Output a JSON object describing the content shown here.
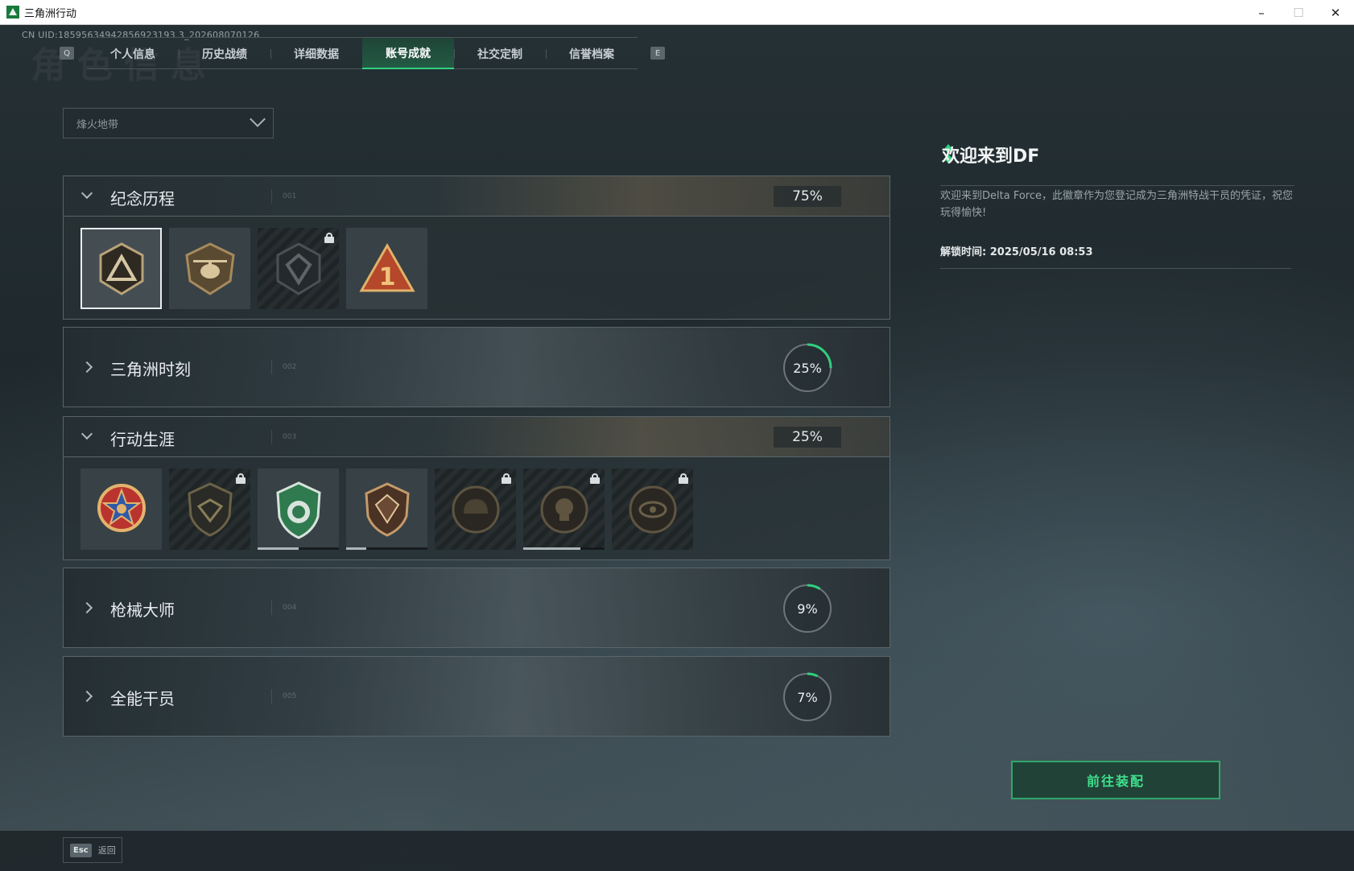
{
  "window": {
    "title": "三角洲行动",
    "controls": [
      "–",
      "☐",
      "✕"
    ]
  },
  "header": {
    "uid": "CN UID:18595634942856923193 3_202608070126",
    "watermark": "角色信息",
    "tab_prev_key": "Q",
    "tab_next_key": "E",
    "tabs": [
      {
        "label": "个人信息"
      },
      {
        "label": "历史战绩"
      },
      {
        "label": "详细数据"
      },
      {
        "label": "账号成就",
        "active": true
      },
      {
        "label": "社交定制"
      },
      {
        "label": "信誉档案"
      }
    ]
  },
  "filter": {
    "selected": "烽火地带"
  },
  "sections": [
    {
      "title": "纪念历程",
      "num": "001",
      "percent": "75%",
      "expanded": true,
      "badges": [
        {
          "name": "delta-emblem-badge",
          "locked": false,
          "selected": true
        },
        {
          "name": "helicopter-badge",
          "locked": false
        },
        {
          "name": "shield-emblem-badge",
          "locked": true
        },
        {
          "name": "rank-one-badge",
          "locked": false
        }
      ]
    },
    {
      "title": "三角洲时刻",
      "num": "002",
      "percent": "25%",
      "expanded": false,
      "progress": 0.25
    },
    {
      "title": "行动生涯",
      "num": "003",
      "percent": "25%",
      "expanded": true,
      "badges": [
        {
          "name": "star-medal-badge",
          "locked": false
        },
        {
          "name": "bird-shield-badge",
          "locked": true
        },
        {
          "name": "green-shield-badge",
          "locked": false,
          "progress": 0.5
        },
        {
          "name": "gem-shield-badge",
          "locked": false,
          "progress": 0.25
        },
        {
          "name": "helmet-badge",
          "locked": true
        },
        {
          "name": "skull-badge",
          "locked": true,
          "progress": 0.7
        },
        {
          "name": "eye-badge",
          "locked": true
        }
      ]
    },
    {
      "title": "枪械大师",
      "num": "004",
      "percent": "9%",
      "expanded": false,
      "progress": 0.09
    },
    {
      "title": "全能干员",
      "num": "005",
      "percent": "7%",
      "expanded": false,
      "progress": 0.07
    }
  ],
  "detail": {
    "title": "欢迎来到DF",
    "description": "欢迎来到Delta Force，此徽章作为您登记成为三角洲特战干员的凭证，祝您玩得愉快!",
    "unlock_time": "解锁时间: 2025/05/16 08:53",
    "equip_button": "前往装配"
  },
  "footer": {
    "esc_key": "Esc",
    "esc_label": "返回"
  },
  "colors": {
    "accent": "#31d07d",
    "ring_track": "#6d777b"
  }
}
